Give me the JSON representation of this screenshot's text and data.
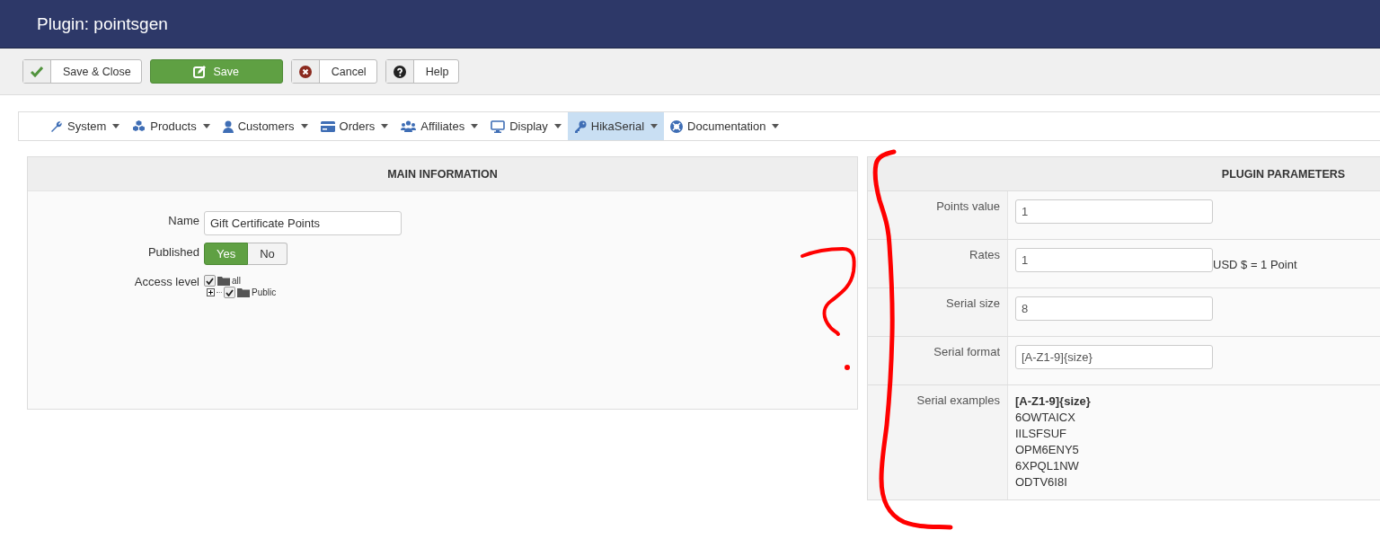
{
  "window": {
    "title": "Plugin: pointsgen"
  },
  "toolbar": [
    {
      "label": "Save & Close",
      "kind": "check",
      "primary": false
    },
    {
      "label": "Save",
      "kind": "edit",
      "primary": true
    },
    {
      "label": "Cancel",
      "kind": "cancel",
      "primary": false
    },
    {
      "label": "Help",
      "kind": "help",
      "primary": false
    }
  ],
  "menu": [
    {
      "label": "System",
      "kind": "wrench",
      "selected": false
    },
    {
      "label": "Products",
      "kind": "cubes",
      "selected": false
    },
    {
      "label": "Customers",
      "kind": "user",
      "selected": false
    },
    {
      "label": "Orders",
      "kind": "card",
      "selected": false
    },
    {
      "label": "Affiliates",
      "kind": "users",
      "selected": false
    },
    {
      "label": "Display",
      "kind": "monitor",
      "selected": false
    },
    {
      "label": "HikaSerial",
      "kind": "key",
      "selected": true
    },
    {
      "label": "Documentation",
      "kind": "lifebuoy",
      "selected": false
    }
  ],
  "main_information": {
    "title": "MAIN INFORMATION",
    "name": {
      "label": "Name",
      "value": "Gift Certificate Points"
    },
    "published": {
      "label": "Published",
      "options": [
        {
          "label": "Yes",
          "selected": true
        },
        {
          "label": "No",
          "selected": false
        }
      ]
    },
    "access_level": {
      "label": "Access level",
      "tree": [
        {
          "label": "all",
          "checked": true,
          "children": [
            {
              "label": "Public",
              "checked": true,
              "expandable": true
            }
          ]
        }
      ]
    }
  },
  "plugin_parameters": {
    "title": "PLUGIN PARAMETERS",
    "rows": [
      {
        "kind": "input",
        "label": "Points value",
        "value": "1"
      },
      {
        "kind": "input",
        "label": "Rates",
        "value": "1",
        "suffix": "USD $ = 1 Point"
      },
      {
        "kind": "input",
        "label": "Serial size",
        "value": "8"
      },
      {
        "kind": "input",
        "label": "Serial format",
        "value": "[A-Z1-9]{size}"
      },
      {
        "kind": "examples",
        "label": "Serial examples",
        "heading": "[A-Z1-9]{size}",
        "examples": [
          "6OWTAICX",
          "IILSFSUF",
          "OPM6ENY5",
          "6XPQL1NW",
          "ODTV6I8I"
        ]
      }
    ]
  }
}
